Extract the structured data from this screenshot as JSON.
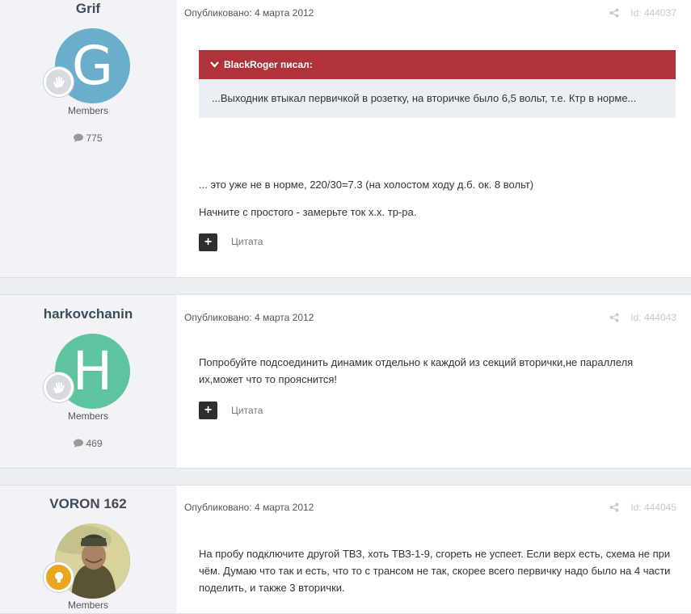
{
  "posts": [
    {
      "author": "Grif",
      "avatar_letter": "G",
      "avatar_color": "#6aaecb",
      "group": "Members",
      "post_count": "775",
      "published": "Опубликовано: 4 марта 2012",
      "post_id": "Id: 444037",
      "quote": {
        "author_label": "BlackRoger писал:",
        "text": "...Выходник втыкал первичкой в розетку, на вторичке было 6,5 вольт, т.е. Ктр в норме..."
      },
      "paragraphs": [
        "... это уже не в норме, 220/30=7.3 (на холостом ходу д.б. ок. 8 вольт)",
        "Начните с простого - замерьте ток х.х. тр-ра."
      ],
      "quote_button": "Цитата"
    },
    {
      "author": "harkovchanin",
      "avatar_letter": "H",
      "avatar_color": "#5ec4a0",
      "group": "Members",
      "post_count": "469",
      "published": "Опубликовано: 4 марта 2012",
      "post_id": "Id: 444043",
      "paragraphs": [
        "Попробуйте подсоединить динамик отдельно к каждой из секций вторички,не параллеля их,может что то прояснится!"
      ],
      "quote_button": "Цитата"
    },
    {
      "author": "VORON 162",
      "group": "Members",
      "published": "Опубликовано: 4 марта 2012",
      "post_id": "Id: 444045",
      "paragraphs": [
        "На пробу подключите другой ТВЗ, хоть ТВЗ-1-9, сгореть не успеет. Если верх есть, схема не при чём. Думаю что так и есть, что то с трансом не так, скорее всего первичку надо было на 4 части поделить, и также 3 вторички."
      ]
    }
  ],
  "colors": {
    "quote_header": "#b0333c",
    "author_column": "#f1f3f6",
    "rank_gold": "#e8a721"
  },
  "icons": {
    "rank_badge": "hand-icon",
    "rank_badge_gold": "lightbulb-icon",
    "post_count": "comment-icon",
    "share": "share-icon",
    "quote_toggle": "chevron-down-icon",
    "multiquote": "plus-icon"
  }
}
